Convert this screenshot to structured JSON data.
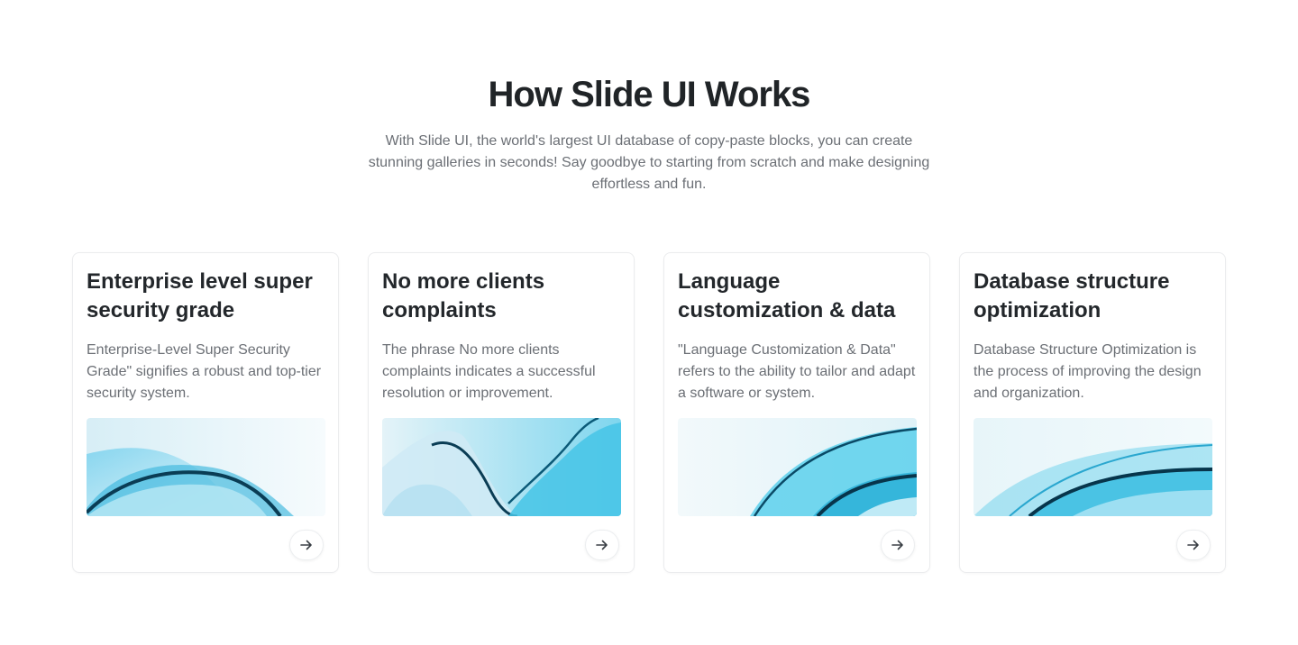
{
  "section": {
    "heading": "How Slide UI Works",
    "subtitle": "With Slide UI, the world's largest UI database of copy-paste blocks, you can create stunning galleries in seconds! Say goodbye to starting from scratch and make designing effortless and fun."
  },
  "cards": [
    {
      "title": "Enterprise level super security grade",
      "description": "Enterprise-Level Super Security Grade\" signifies a robust and top-tier security system.",
      "image_icon": "abstract-wave-image",
      "arrow_icon": "arrow-right-icon"
    },
    {
      "title": "No more clients complaints",
      "description": "The phrase No more clients complaints indicates a successful resolution or improvement.",
      "image_icon": "abstract-wave-image",
      "arrow_icon": "arrow-right-icon"
    },
    {
      "title": "Language customization & data",
      "description": "\"Language Customization & Data\" refers to the ability to tailor and adapt a software or system.",
      "image_icon": "abstract-wave-image",
      "arrow_icon": "arrow-right-icon"
    },
    {
      "title": "Database structure optimization",
      "description": "Database Structure Optimization is the process of improving the design and organization.",
      "image_icon": "abstract-wave-image",
      "arrow_icon": "arrow-right-icon"
    }
  ],
  "colors": {
    "heading": "#202427",
    "body_text": "#6b6f75",
    "card_border": "#ebecee",
    "accent_cyan": "#3cc6e8",
    "accent_deep": "#0a3d55"
  }
}
